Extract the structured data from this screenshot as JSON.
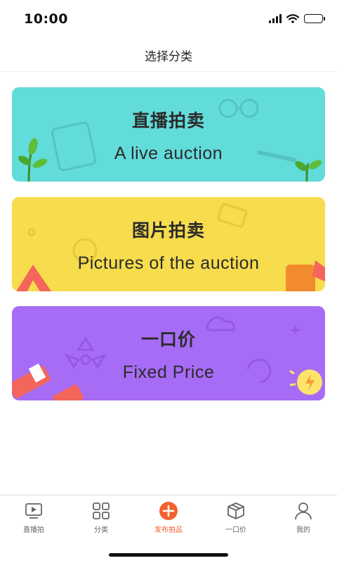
{
  "status_bar": {
    "time": "10:00"
  },
  "nav": {
    "title": "选择分类"
  },
  "cards": [
    {
      "title": "直播拍卖",
      "subtitle": "A live auction",
      "color": "#62dcda"
    },
    {
      "title": "图片拍卖",
      "subtitle": "Pictures of the auction",
      "color": "#f7dc4d"
    },
    {
      "title": "一口价",
      "subtitle": "Fixed Price",
      "color": "#a76cf6"
    }
  ],
  "tabs": [
    {
      "label": "直播拍",
      "icon": "video-play-icon"
    },
    {
      "label": "分类",
      "icon": "grid-icon"
    },
    {
      "label": "发布拍品",
      "icon": "plus-circle-icon",
      "active": true
    },
    {
      "label": "一口价",
      "icon": "box-icon"
    },
    {
      "label": "我的",
      "icon": "person-icon"
    }
  ],
  "colors": {
    "accent": "#f2612d",
    "tab_inactive": "#666666"
  }
}
